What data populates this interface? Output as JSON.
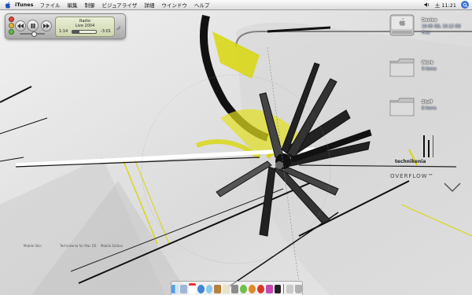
{
  "menubar": {
    "app_name": "iTunes",
    "menus": [
      "ファイル",
      "編集",
      "制御",
      "ビジュアライザ",
      "詳細",
      "ウインドウ",
      "ヘルプ"
    ],
    "clock": "土 11:21"
  },
  "itunes": {
    "station": "Radio",
    "track": "Live 2004",
    "elapsed": "1:14",
    "remaining": "-3:01",
    "progress_fraction": 0.29,
    "volume_fraction": 0.55
  },
  "desktop_icons": [
    {
      "name": "Devine",
      "info": "19.05 GB, 19.12 GB Free"
    },
    {
      "name": "Work",
      "info": "9 items"
    },
    {
      "name": "Stuff",
      "info": "8 items"
    }
  ],
  "wallpaper": {
    "brand": "technikenia",
    "overflow": "OVERFLOW™",
    "caption_left": "Mobile Skin",
    "caption_mid": "Technikenia for Mac OS",
    "caption_right": "Mobile Edition"
  },
  "colors": {
    "accent_yellow": "#d9d70a",
    "menubar_bg": "#ececec",
    "lcd_bg": "#dfe6c6"
  },
  "dock": {
    "items": [
      "finder-icon",
      "mail-icon",
      "calendar-icon",
      "safari-icon",
      "ichat-icon",
      "address-book-icon",
      "preview-icon",
      "system-prefs-icon",
      "itunes-icon",
      "iphoto-icon",
      "garageband-icon",
      "app-icon",
      "terminal-icon",
      "documents-icon",
      "trash-icon"
    ]
  }
}
